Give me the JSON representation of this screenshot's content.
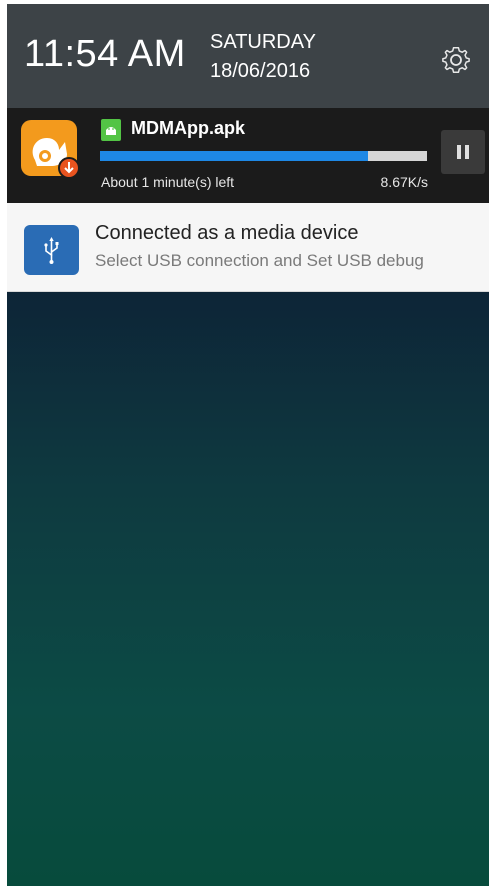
{
  "header": {
    "time": "11:54 AM",
    "day": "SATURDAY",
    "date": "18/06/2016",
    "settings_icon": "gear-icon"
  },
  "download": {
    "app_icon": "uc-browser-download-icon",
    "file_icon": "android-apk-icon",
    "file_name": "MDMApp.apk",
    "progress_fraction": 0.82,
    "time_left": "About 1 minute(s) left",
    "speed": "8.67K/s",
    "pause_icon": "pause-icon",
    "accent_color": "#1e88e5"
  },
  "usb": {
    "icon": "usb-icon",
    "title": "Connected as a media device",
    "subtitle": "Select USB connection and Set USB debug",
    "icon_color": "#2a6cb5"
  }
}
